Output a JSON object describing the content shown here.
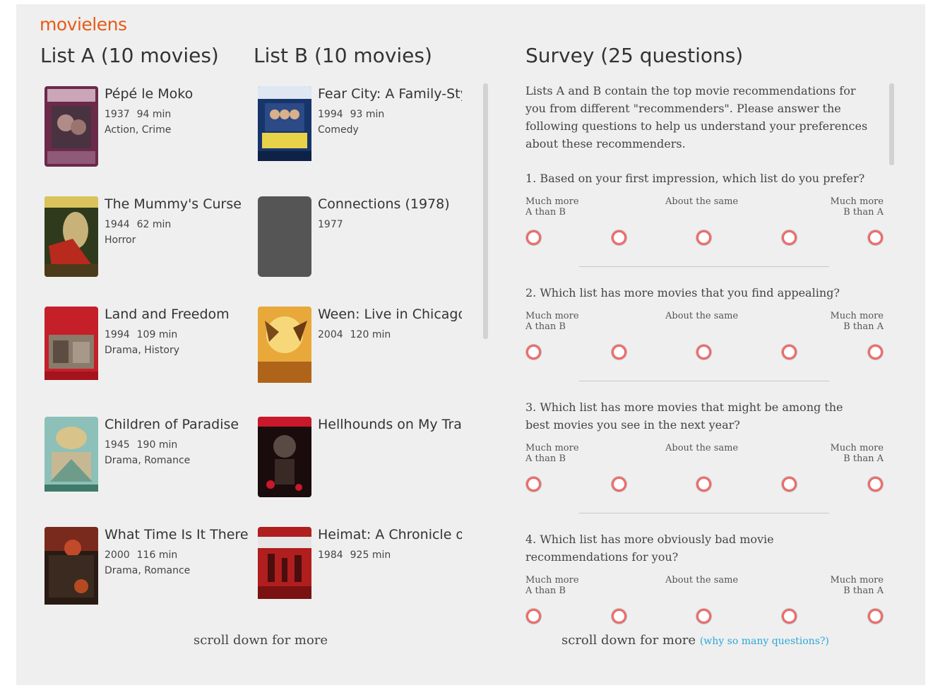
{
  "logo": "movielens",
  "list_a": {
    "title": "List A (10 movies)",
    "movies": [
      {
        "title": "Pépé le Moko",
        "year": "1937",
        "runtime": "94 min",
        "genres": "Action, Crime"
      },
      {
        "title": "The Mummy's Curse",
        "year": "1944",
        "runtime": "62 min",
        "genres": "Horror"
      },
      {
        "title": "Land and Freedom",
        "year": "1994",
        "runtime": "109 min",
        "genres": "Drama, History"
      },
      {
        "title": "Children of Paradise",
        "year": "1945",
        "runtime": "190 min",
        "genres": "Drama, Romance"
      },
      {
        "title": "What Time Is It There?",
        "year": "2000",
        "runtime": "116 min",
        "genres": "Drama, Romance"
      }
    ],
    "scroll_hint": "scroll down for more"
  },
  "list_b": {
    "title": "List B (10 movies)",
    "movies": [
      {
        "title": "Fear City: A Family-Sty",
        "year": "1994",
        "runtime": "93 min",
        "genres": "Comedy"
      },
      {
        "title": "Connections (1978)",
        "year": "1977",
        "runtime": "",
        "genres": ""
      },
      {
        "title": "Ween: Live in Chicago",
        "year": "2004",
        "runtime": "120 min",
        "genres": ""
      },
      {
        "title": "Hellhounds on My Trail",
        "year": "",
        "runtime": "",
        "genres": ""
      },
      {
        "title": "Heimat: A Chronicle of",
        "year": "1984",
        "runtime": "925 min",
        "genres": ""
      }
    ]
  },
  "survey": {
    "title": "Survey (25 questions)",
    "intro": "Lists A and B contain the top movie recommendations for you from different \"recommenders\". Please answer the following questions to help us understand your preferences about these recommenders.",
    "scale": {
      "left_line1": "Much more",
      "left_line2": "A than B",
      "middle": "About the same",
      "right_line1": "Much more",
      "right_line2": "B than A"
    },
    "questions": [
      {
        "text": "1. Based on your first impression, which list do you prefer?"
      },
      {
        "text": "2. Which list has more movies that you find appealing?"
      },
      {
        "text": "3. Which list has more movies that might be among the best movies you see in the next year?"
      },
      {
        "text": "4. Which list has more obviously bad movie recommendations for you?"
      }
    ],
    "scroll_hint": "scroll down for more",
    "why_link": "(why so many questions?)"
  },
  "colors": {
    "brand": "#e65a17",
    "radio_ring": "#f06a6a",
    "link": "#2aa7d8",
    "panel_bg": "#efefef"
  }
}
